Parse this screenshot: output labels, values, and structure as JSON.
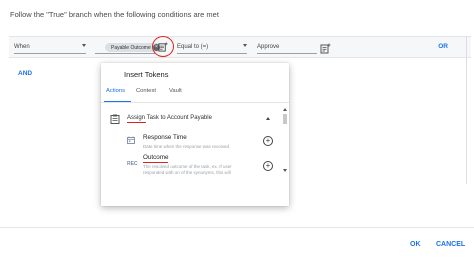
{
  "dialog": {
    "instruction": "Follow the \"True\" branch when the following conditions are met",
    "ok_label": "OK",
    "cancel_label": "CANCEL"
  },
  "condition": {
    "when_label": "When",
    "token_chip": "Payable Outcome",
    "operator": "Equal to (=)",
    "value": "Approve",
    "or_label": "OR",
    "and_label": "AND"
  },
  "insert_tokens": {
    "title": "Insert Tokens",
    "tabs": [
      "Actions",
      "Context",
      "Vault"
    ],
    "active_tab": "Actions",
    "group": {
      "label": "Assign Task to Account Payable",
      "expanded": true
    },
    "items": [
      {
        "icon": "calendar-icon",
        "name": "Response Time",
        "description": "Date time when the response was received."
      },
      {
        "icon": "text-type-icon",
        "icon_text": "REC",
        "name": "Outcome",
        "description": "The resolved outcome of the task, ex. If user responded with on of the synonyms, this will"
      }
    ]
  },
  "colors": {
    "accent": "#1a73e8",
    "annotation_red": "#d9261c"
  }
}
